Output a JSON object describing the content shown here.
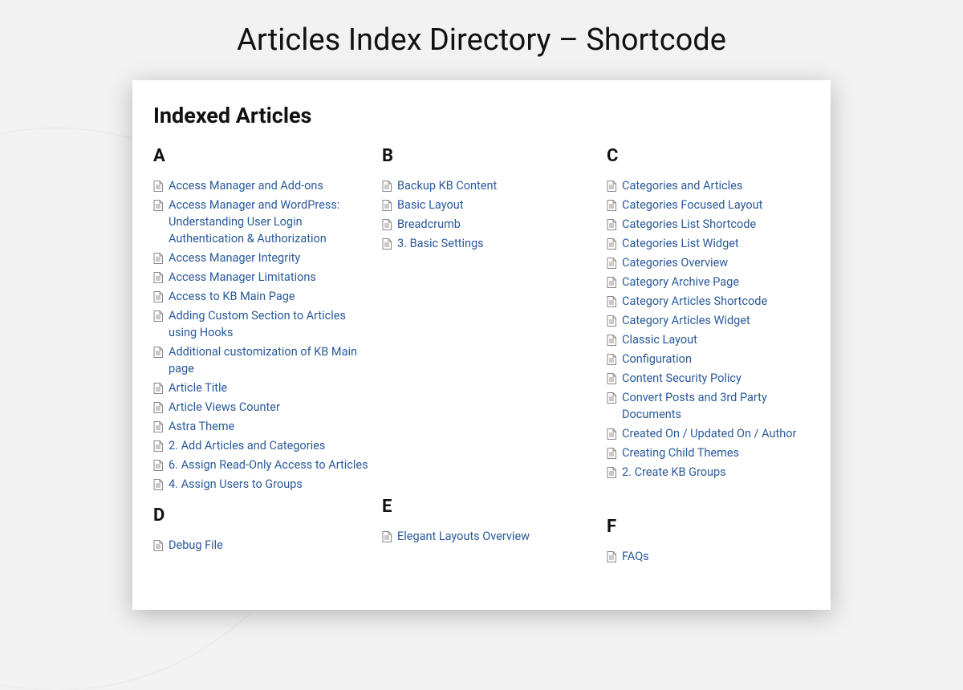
{
  "page_title": "Articles Index Directory – Shortcode",
  "panel_heading": "Indexed Articles",
  "columns": [
    {
      "sections": [
        {
          "letter": "A",
          "articles": [
            "Access Manager and Add-ons",
            "Access Manager and WordPress: Understanding User Login Authentication & Authorization",
            "Access Manager Integrity",
            "Access Manager Limitations",
            "Access to KB Main Page",
            "Adding Custom Section to Articles using Hooks",
            "Additional customization of KB Main page",
            "Article Title",
            "Article Views Counter",
            "Astra Theme",
            "2. Add Articles and Categories",
            "6. Assign Read-Only Access to Articles",
            "4. Assign Users to Groups"
          ]
        },
        {
          "letter": "D",
          "articles": [
            "Debug File"
          ]
        }
      ]
    },
    {
      "sections": [
        {
          "letter": "B",
          "articles": [
            "Backup KB Content",
            "Basic Layout",
            "Breadcrumb",
            "3. Basic Settings"
          ]
        },
        {
          "letter": "E",
          "articles": [
            "Elegant Layouts Overview"
          ]
        }
      ]
    },
    {
      "sections": [
        {
          "letter": "C",
          "articles": [
            "Categories and Articles",
            "Categories Focused Layout",
            "Categories List Shortcode",
            "Categories List Widget",
            "Categories Overview",
            "Category Archive Page",
            "Category Articles Shortcode",
            "Category Articles Widget",
            "Classic Layout",
            "Configuration",
            "Content Security Policy",
            "Convert Posts and 3rd Party Documents",
            "Created On / Updated On / Author",
            "Creating Child Themes",
            "2. Create KB Groups"
          ]
        },
        {
          "letter": "F",
          "articles": [
            "FAQs"
          ]
        }
      ]
    }
  ],
  "second_row_spacer_heights": [
    0,
    305,
    45
  ]
}
